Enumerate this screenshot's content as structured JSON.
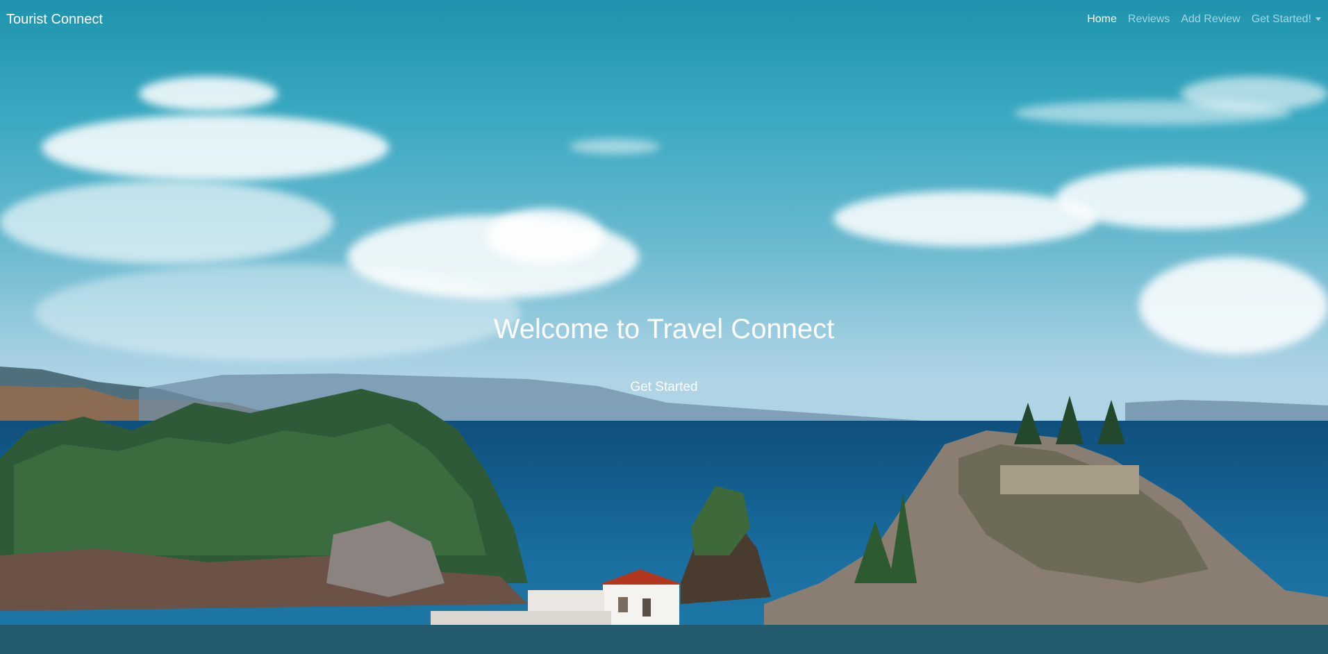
{
  "navbar": {
    "brand": "Tourist Connect",
    "links": [
      {
        "label": "Home",
        "active": true
      },
      {
        "label": "Reviews",
        "active": false
      },
      {
        "label": "Add Review",
        "active": false
      },
      {
        "label": "Get Started!",
        "active": false,
        "dropdown": true
      }
    ]
  },
  "hero": {
    "title": "Welcome to Travel Connect",
    "button_label": "Get Started",
    "background": "photo-island-coast-with-white-chapel"
  },
  "colors": {
    "sky_top": "#1f93ad",
    "sea": "#135f8f",
    "nav_text": "#ffffff"
  }
}
